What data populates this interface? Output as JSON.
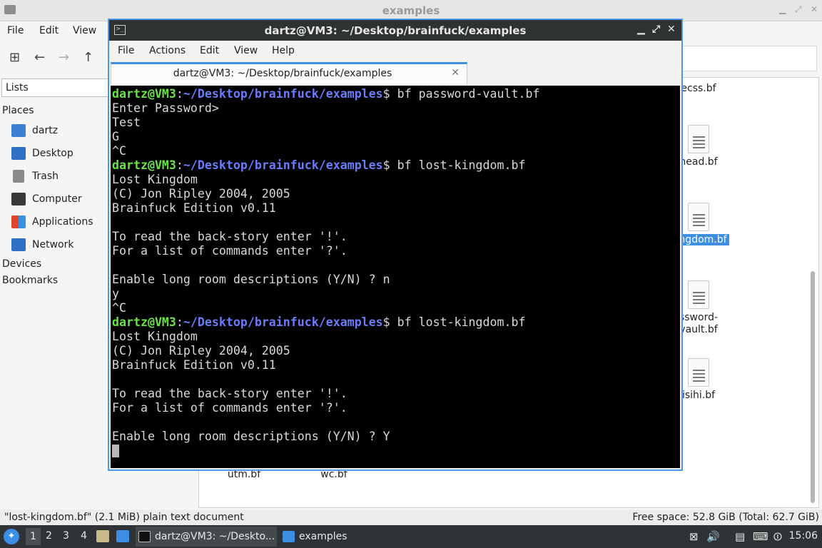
{
  "file_manager": {
    "title": "examples",
    "menu": [
      "File",
      "Edit",
      "View"
    ],
    "sidebar": {
      "lists_label": "Lists",
      "places_header": "Places",
      "places": [
        {
          "label": "dartz",
          "icon": "home-folder-icon"
        },
        {
          "label": "Desktop",
          "icon": "desktop-icon"
        },
        {
          "label": "Trash",
          "icon": "trash-icon"
        },
        {
          "label": "Computer",
          "icon": "computer-icon"
        },
        {
          "label": "Applications",
          "icon": "applications-icon"
        },
        {
          "label": "Network",
          "icon": "network-icon"
        }
      ],
      "devices_header": "Devices",
      "bookmarks_header": "Bookmarks"
    },
    "files": [
      {
        "name": "ecss.bf"
      },
      {
        "name": "head.bf"
      },
      {
        "name": "kingdom.bf",
        "selected": true
      },
      {
        "name": "ssword-\nvault.bf"
      },
      {
        "name": "isihi.bf"
      },
      {
        "name": "utm.bf"
      },
      {
        "name": "wc.bf"
      }
    ],
    "status_left": "\"lost-kingdom.bf\" (2.1 MiB) plain text document",
    "status_right": "Free space: 52.8 GiB (Total: 62.7 GiB)"
  },
  "terminal": {
    "title": "dartz@VM3: ~/Desktop/brainfuck/examples",
    "menu": [
      "File",
      "Actions",
      "Edit",
      "View",
      "Help"
    ],
    "tab_label": "dartz@VM3: ~/Desktop/brainfuck/examples",
    "lines": [
      {
        "user": "dartz@VM3",
        "path": "~/Desktop/brainfuck/examples",
        "cmd": "$ bf password-vault.bf"
      },
      {
        "text": "Enter Password>"
      },
      {
        "text": "Test"
      },
      {
        "text": "G"
      },
      {
        "text": "^C"
      },
      {
        "user": "dartz@VM3",
        "path": "~/Desktop/brainfuck/examples",
        "cmd": "$ bf lost-kingdom.bf"
      },
      {
        "text": "Lost Kingdom"
      },
      {
        "text": "(C) Jon Ripley 2004, 2005"
      },
      {
        "text": "Brainfuck Edition v0.11"
      },
      {
        "text": ""
      },
      {
        "text": "To read the back-story enter '!'."
      },
      {
        "text": "For a list of commands enter '?'."
      },
      {
        "text": ""
      },
      {
        "text": "Enable long room descriptions (Y/N) ? n"
      },
      {
        "text": "y"
      },
      {
        "text": "^C"
      },
      {
        "user": "dartz@VM3",
        "path": "~/Desktop/brainfuck/examples",
        "cmd": "$ bf lost-kingdom.bf"
      },
      {
        "text": "Lost Kingdom"
      },
      {
        "text": "(C) Jon Ripley 2004, 2005"
      },
      {
        "text": "Brainfuck Edition v0.11"
      },
      {
        "text": ""
      },
      {
        "text": "To read the back-story enter '!'."
      },
      {
        "text": "For a list of commands enter '?'."
      },
      {
        "text": ""
      },
      {
        "text": "Enable long room descriptions (Y/N) ? Y"
      }
    ]
  },
  "taskbar": {
    "workspaces": [
      "1",
      "2",
      "3",
      "4"
    ],
    "active_workspace": "1",
    "tasks": [
      {
        "label": "dartz@VM3: ~/Deskto...",
        "icon": "terminal-icon",
        "active": true
      },
      {
        "label": "examples",
        "icon": "folder-icon",
        "active": false
      }
    ],
    "clock": "15:06"
  },
  "colors": {
    "accent": "#3d8fe4",
    "prompt_user": "#6be24a",
    "prompt_path": "#6b7dfb",
    "terminal_bg": "#000000",
    "taskbar_bg": "#2f3335"
  }
}
